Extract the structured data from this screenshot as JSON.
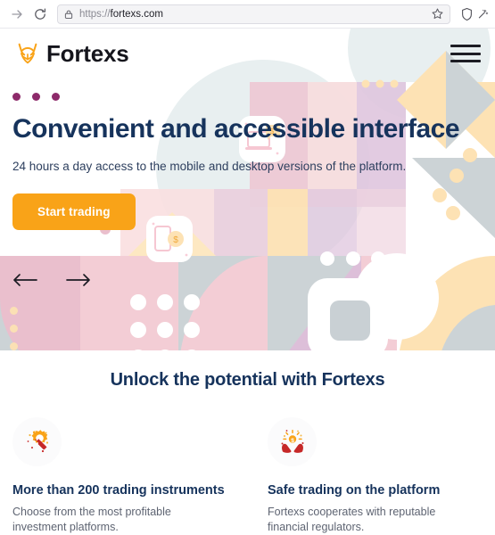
{
  "browser": {
    "forward_icon": "arrow-right-icon",
    "reload_icon": "reload-icon",
    "lock_icon": "lock-icon",
    "url_scheme": "https://",
    "url_host": "fortexs.com",
    "url_full": "https://fortexs.com",
    "bookmark_icon": "star-icon",
    "shield_icon": "shield-icon",
    "extension_icon": "sparkle-wand-icon"
  },
  "site": {
    "logo_text": "Fortexs",
    "logo_icon": "fox-head-logo-icon",
    "logo_color": "#f9a318",
    "menu_icon": "hamburger-menu-icon"
  },
  "hero": {
    "title": "Convenient and accessible interface",
    "subtitle": "24 hours a day access to the mobile and desktop versions of the platform.",
    "cta_label": "Start trading",
    "cta_color": "#f9a318",
    "title_color": "#16335c",
    "slide_dots": 3,
    "slide_dot_color": "#8d2a6a",
    "side_dots": 3,
    "side_dot_color": "#fbe0b4",
    "prev_icon": "arrow-left-icon",
    "next_icon": "arrow-right-icon",
    "card_phone_icon": "phone-coin-card-icon",
    "card_laptop_icon": "laptop-chat-card-icon"
  },
  "features": {
    "heading": "Unlock the potential with Fortexs",
    "items": [
      {
        "icon": "gear-wrench-icon",
        "title": "More than 200 trading instruments",
        "description": "Choose from the most profitable investment platforms."
      },
      {
        "icon": "hands-coin-icon",
        "title": "Safe trading on the platform",
        "description": "Fortexs cooperates with reputable financial regulators."
      }
    ]
  }
}
